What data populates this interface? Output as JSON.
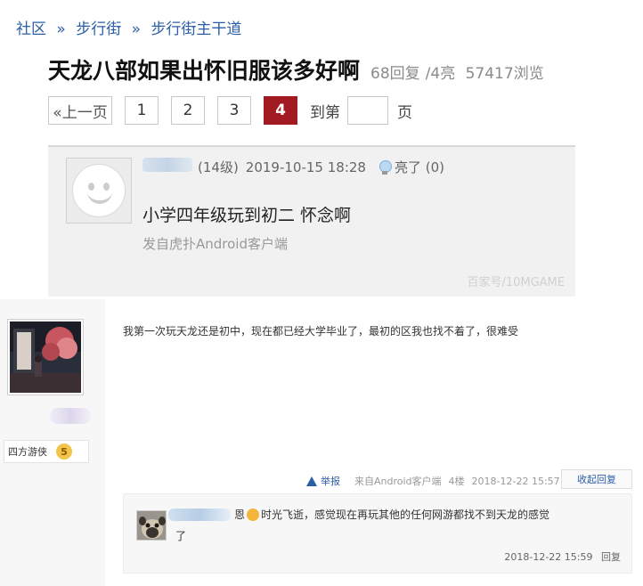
{
  "breadcrumb": {
    "items": [
      "社区",
      "步行街",
      "步行街主干道"
    ],
    "separator": "»"
  },
  "thread": {
    "title": "天龙八部如果出怀旧服该多好啊",
    "reply_count": "68回复",
    "light_count": "/4亮",
    "views": "57417浏览"
  },
  "pager": {
    "prev_label": "«上一页",
    "pages": [
      "1",
      "2",
      "3",
      "4"
    ],
    "current_page": "4",
    "goto_label": "到第",
    "goto_value": "",
    "goto_suffix": "页"
  },
  "quoted_post": {
    "level": "(14级)",
    "datetime": "2019-10-15 18:28",
    "light_label": "亮了 (0)",
    "body": "小学四年级玩到初二 怀念啊",
    "source": "发自虎扑Android客户端",
    "watermark": "百家号/10MGAME"
  },
  "reply": {
    "username": "四方游侠",
    "level_badge": "5",
    "text": "我第一次玩天龙还是初中，现在都已经大学毕业了，最初的区我也找不着了，很难受",
    "report_label": "举报",
    "source": "来自Android客户端",
    "floor": "4楼",
    "datetime": "2018-12-22 15:57",
    "collapse_label": "收起回复"
  },
  "sub_reply": {
    "text_prefix": "恩",
    "text_main": "时光飞逝，感觉现在再玩其他的任何网游都找不到天龙的感觉",
    "text_tail": "了",
    "datetime": "2018-12-22 15:59",
    "reply_label": "回复"
  },
  "icons": {
    "bulb": "lightbulb-icon",
    "warning": "warning-triangle-icon",
    "smile": "smile-emoji-icon",
    "level": "level-badge-icon"
  },
  "colors": {
    "link": "#2b5ea7",
    "active_page": "#a21b22"
  }
}
